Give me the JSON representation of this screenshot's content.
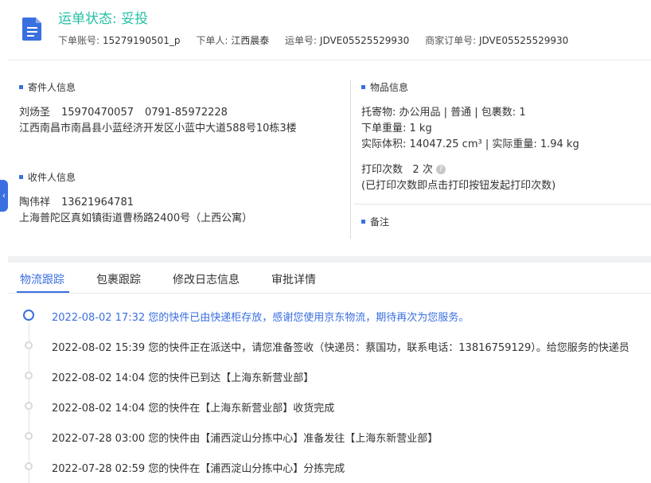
{
  "header": {
    "status_text": "运单状态: 妥投",
    "account_label": "下单账号:",
    "account_value": "15279190501_p",
    "orderer_label": "下单人:",
    "orderer_value": "江西晨泰",
    "waybill_label": "运单号:",
    "waybill_value": "JDVE05525529930",
    "merchant_order_label": "商家订单号:",
    "merchant_order_value": "JDVE05525529930"
  },
  "sender": {
    "title": "寄件人信息",
    "name": "刘炀圣",
    "phone": "15970470057",
    "tel": "0791-85972228",
    "address": "江西南昌市南昌县小蓝经济开发区小蓝中大道588号10栋3楼"
  },
  "receiver": {
    "title": "收件人信息",
    "name": "陶伟祥",
    "phone": "13621964781",
    "address": "上海普陀区真如镇街道曹杨路2400号（上西公寓）"
  },
  "goods": {
    "title": "物品信息",
    "line1": "托寄物:  办公用品 | 普通  |  包裹数:  1",
    "line2": "下单重量:   1 kg",
    "line3": "实际体积:    14047.25 cm³ |  实际重量:   1.94 kg",
    "print_label": "打印次数",
    "print_value": "2 次",
    "help_glyph": "?",
    "print_hint": "(已打印次数即点击打印按钮发起打印次数)"
  },
  "remark": {
    "title": "备注"
  },
  "side_tab_glyph": "‹",
  "tabs": [
    "物流跟踪",
    "包裹跟踪",
    "修改日志信息",
    "审批详情"
  ],
  "tracking": [
    {
      "text": "2022-08-02 17:32 您的快件已由快递柜存放，感谢您使用京东物流，期待再次为您服务。",
      "active": true
    },
    {
      "text": "2022-08-02 15:39 您的快件正在派送中，请您准备签收（快递员：蔡国功，联系电话：13816759129）。给您服务的快递员",
      "active": false
    },
    {
      "text": "2022-08-02 14:04 您的快件已到达【上海东新营业部】",
      "active": false
    },
    {
      "text": "2022-08-02 14:04 您的快件在【上海东新营业部】收货完成",
      "active": false
    },
    {
      "text": "2022-07-28 03:00 您的快件由【浦西淀山分拣中心】准备发往【上海东新营业部】",
      "active": false
    },
    {
      "text": "2022-07-28 02:59 您的快件在【浦西淀山分拣中心】分拣完成",
      "active": false
    }
  ],
  "colors": {
    "accent": "#3a6fe0",
    "status_green": "#26c0a6"
  },
  "icons": {
    "document": "document-icon",
    "help": "help-circle-icon",
    "collapse": "chevron-left-icon"
  }
}
